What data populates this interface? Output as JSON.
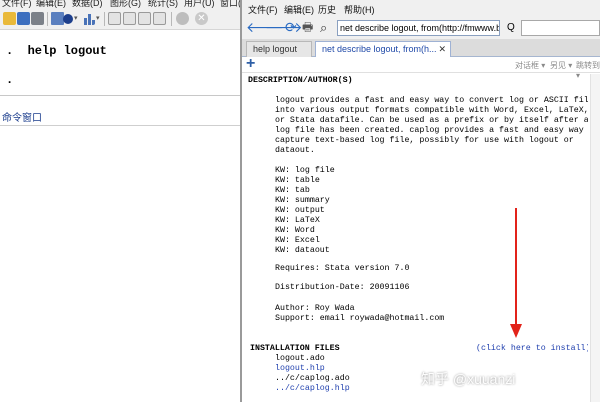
{
  "stata": {
    "menu": [
      "文件(F)",
      "编辑(E)",
      "数据(D)",
      "图形(G)",
      "统计(S)",
      "用户(U)",
      "窗口(W)"
    ],
    "results_lines": [
      ".  help logout",
      "."
    ],
    "command_window_title": "命令窗口"
  },
  "viewer": {
    "menu": [
      "文件(F)",
      "编辑(E)",
      "历史",
      "帮助(H)"
    ],
    "address": "net describe logout, from(http://fmwww.bc.edu",
    "find_label": "Q",
    "tabs": [
      {
        "label": "help logout",
        "active": false
      },
      {
        "label": "net describe logout, from(h...",
        "active": true
      }
    ],
    "tab_close": "✕",
    "toolbar2": {
      "plus": "+",
      "items": [
        "对话框 ▾",
        "另见 ▾",
        "跳转到 ▾"
      ]
    },
    "doc": {
      "heading": "DESCRIPTION/AUTHOR(S)",
      "description": [
        "logout provides a fast and easy way to convert log or ASCII files",
        "into various output formats compatible with Word, Excel, LaTeX,",
        "or Stata datafile. Can be used as a prefix or by itself after a",
        "log file has been created. caplog provides a fast and easy way to",
        "capture text-based log file, possibly for use with logout or",
        "dataout."
      ],
      "keywords": [
        "KW: log file",
        "KW: table",
        "KW: tab",
        "KW: summary",
        "KW: output",
        "KW: LaTeX",
        "KW: Word",
        "KW: Excel",
        "KW: dataout"
      ],
      "requires": "Requires: Stata version 7.0",
      "distribution_date": "Distribution-Date: 20091106",
      "author": "Author: Roy Wada",
      "support": "Support: email roywada@hotmail.com",
      "installation_heading": "INSTALLATION FILES",
      "install_link": "(click here to install)",
      "files": [
        "logout.ado",
        "logout.hlp",
        "../c/caplog.ado",
        "../c/caplog.hlp"
      ]
    },
    "watermark": "知乎 @xuuanzi"
  },
  "colors": {
    "link": "#1f3fae",
    "arrow": "#e2231a",
    "accent": "#2e5fa6"
  }
}
